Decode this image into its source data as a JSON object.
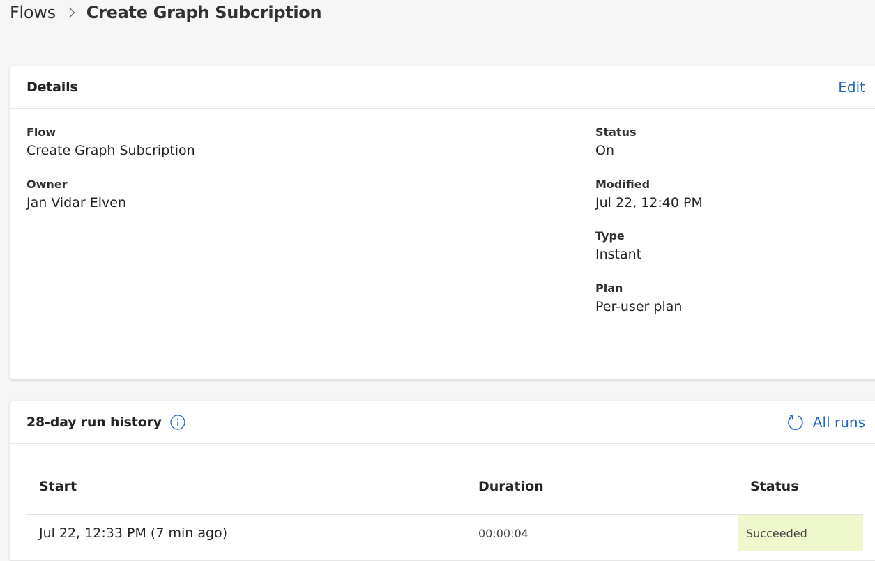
{
  "breadcrumb": {
    "parent": "Flows",
    "current": "Create Graph Subcription"
  },
  "details": {
    "title": "Details",
    "edit_label": "Edit",
    "flow": {
      "label": "Flow",
      "value": "Create Graph Subcription"
    },
    "owner": {
      "label": "Owner",
      "value": "Jan Vidar Elven"
    },
    "status": {
      "label": "Status",
      "value": "On"
    },
    "modified": {
      "label": "Modified",
      "value": "Jul 22, 12:40 PM"
    },
    "type": {
      "label": "Type",
      "value": "Instant"
    },
    "plan": {
      "label": "Plan",
      "value": "Per-user plan"
    }
  },
  "run_history": {
    "title": "28-day run history",
    "all_runs_label": "All runs",
    "columns": {
      "start": "Start",
      "duration": "Duration",
      "status": "Status"
    },
    "rows": [
      {
        "start": "Jul 22, 12:33 PM (7 min ago)",
        "duration": "00:00:04",
        "status": "Succeeded"
      }
    ]
  },
  "colors": {
    "link": "#2266c6",
    "succeeded_bg": "#eff7cd",
    "page_bg": "#f6f6f6"
  },
  "icons": {
    "breadcrumb_separator": "chevron-right-icon",
    "info": "info-icon",
    "refresh": "refresh-icon"
  }
}
